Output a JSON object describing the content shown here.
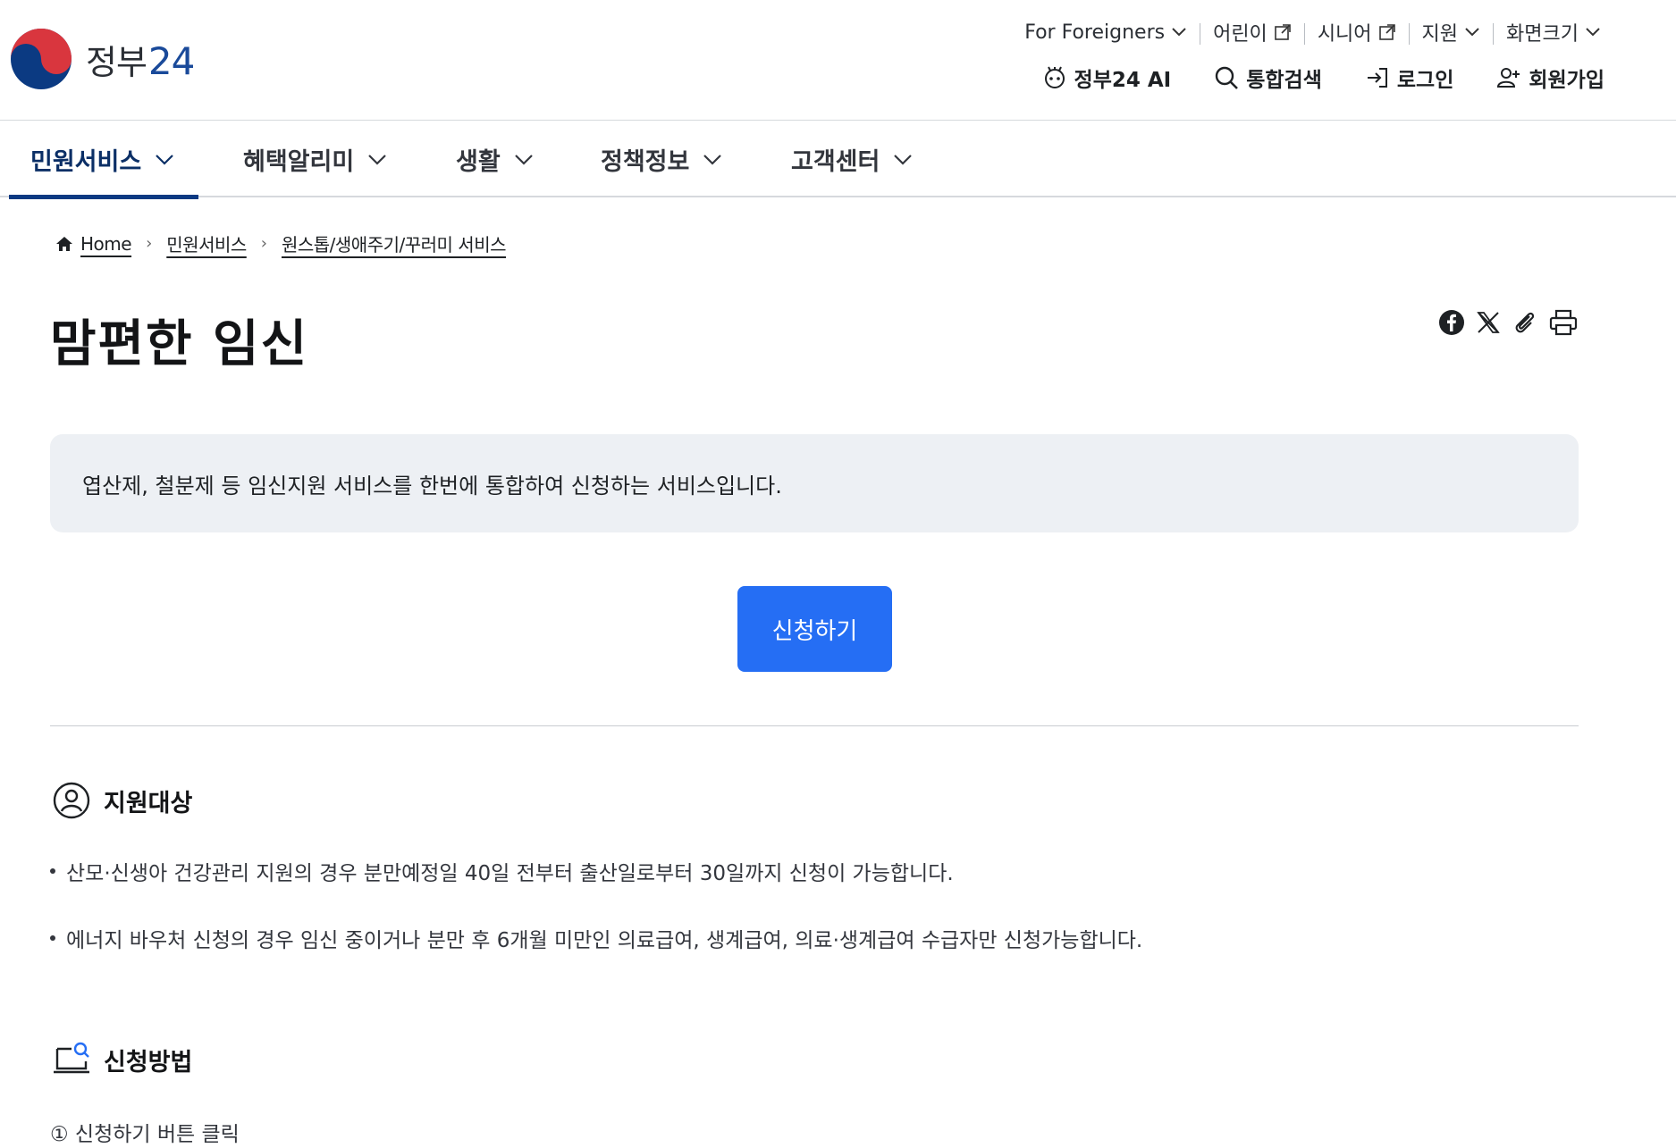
{
  "header": {
    "logo_text": "정부",
    "logo_num": "24",
    "util_links": [
      {
        "label": "For Foreigners",
        "icon": "chevron-down-icon"
      },
      {
        "label": "어린이",
        "icon": "external-link-icon"
      },
      {
        "label": "시니어",
        "icon": "external-link-icon"
      },
      {
        "label": "지원",
        "icon": "chevron-down-icon"
      },
      {
        "label": "화면크기",
        "icon": "chevron-down-icon"
      }
    ],
    "gnb_util": [
      {
        "label": "정부24 AI",
        "icon": "ai-robot-icon"
      },
      {
        "label": "통합검색",
        "icon": "search-icon"
      },
      {
        "label": "로그인",
        "icon": "login-icon"
      },
      {
        "label": "회원가입",
        "icon": "user-add-icon"
      }
    ]
  },
  "nav": {
    "items": [
      {
        "label": "민원서비스",
        "active": true
      },
      {
        "label": "혜택알리미",
        "active": false
      },
      {
        "label": "생활",
        "active": false
      },
      {
        "label": "정책정보",
        "active": false
      },
      {
        "label": "고객센터",
        "active": false
      }
    ]
  },
  "breadcrumb": [
    "Home",
    "민원서비스",
    "원스톱/생애주기/꾸러미 서비스"
  ],
  "page": {
    "title": "맘편한 임신",
    "summary": "엽산제, 철분제 등 임신지원 서비스를 한번에 통합하여 신청하는 서비스입니다.",
    "apply_label": "신청하기"
  },
  "share_icons": [
    "facebook-icon",
    "x-icon",
    "clip-icon",
    "print-icon"
  ],
  "sections": {
    "target": {
      "title": "지원대상",
      "bullets": [
        "산모·신생아 건강관리 지원의 경우 분만예정일 40일 전부터 출산일로부터 30일까지 신청이 가능합니다.",
        "에너지 바우처 신청의 경우 임신 중이거나 분만 후 6개월 미만인 의료급여, 생계급여, 의료·생계급여 수급자만 신청가능합니다."
      ]
    },
    "method": {
      "title": "신청방법",
      "steps": [
        "① 신청하기 버튼 클릭"
      ]
    }
  },
  "colors": {
    "primary": "#256ef4",
    "nav_active": "#0b3a82",
    "summary_bg": "#edf0f4"
  }
}
